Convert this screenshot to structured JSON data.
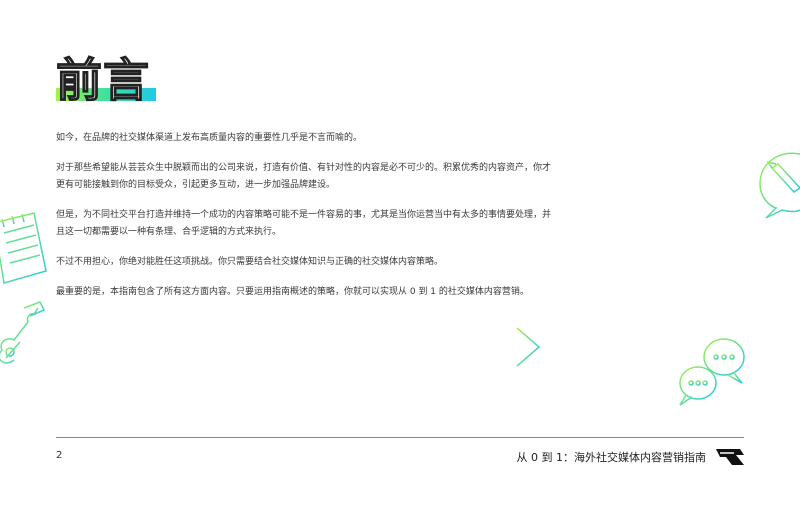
{
  "title": "前言",
  "paragraphs": [
    "如今，在品牌的社交媒体渠道上发布高质量内容的重要性几乎是不言而喻的。",
    "对于那些希望能从芸芸众生中脱颖而出的公司来说，打造有价值、有针对性的内容是必不可少的。积累优秀的内容资产，你才更有可能接触到你的目标受众，引起更多互动，进一步加强品牌建设。",
    "但是，为不同社交平台打造并维持一个成功的内容策略可能不是一件容易的事，尤其是当你运营当中有太多的事情要处理，并且这一切都需要以一种有条理、合乎逻辑的方式来执行。",
    "不过不用担心，你绝对能胜任这项挑战。你只需要结合社交媒体知识与正确的社交媒体内容策略。",
    "最重要的是，本指南包含了所有这方面内容。只要运用指南概述的策略，你就可以实现从 0 到 1 的社交媒体内容营销。"
  ],
  "footer": {
    "page_number": "2",
    "doc_title": "从 0 到 1：海外社交媒体内容营销指南"
  },
  "decorations": {
    "left_icons": [
      "notepad-icon",
      "guitar-icon"
    ],
    "right_icons": [
      "speech-bubble-pencil-icon",
      "arrow-right-icon",
      "chat-bubbles-icon"
    ],
    "accent_colors": [
      "#a6f24a",
      "#3fe0a0",
      "#22c8e8"
    ]
  }
}
